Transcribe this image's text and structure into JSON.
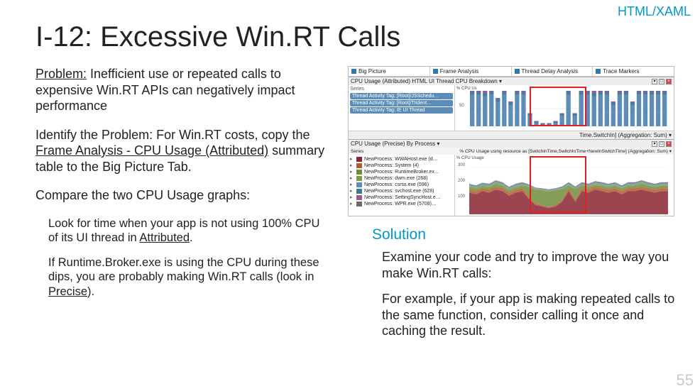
{
  "tag": "HTML/XAML",
  "title": "I-12: Excessive Win.RT Calls",
  "problem": {
    "label": "Problem:",
    "text": " Inefficient use or repeated calls to expensive Win.RT APIs can negatively impact performance"
  },
  "identify": {
    "label": "Identify the Problem:",
    "pre": " For Win.RT costs, copy the ",
    "link": "Frame Analysis - CPU Usage (Attributed)",
    "post": " summary table to the Big Picture Tab."
  },
  "compare": "Compare the two CPU Usage graphs:",
  "sub1": {
    "pre": "Look for time when your app is not using 100% CPU of its UI thread in ",
    "link": "Attributed",
    "post": "."
  },
  "sub2": {
    "pre": "If Runtime.Broker.exe is using the CPU during these dips, you are probably making Win.RT calls (look in ",
    "link": "Precise",
    "post": ")."
  },
  "solution": {
    "head": "Solution",
    "p1": "Examine your code and try to improve the way you make Win.RT calls:",
    "p2": "For example, if your app is making repeated calls to the same function, consider calling it once and caching the result."
  },
  "pagenum": "55",
  "shot": {
    "tabs": [
      "Big Picture",
      "Frame Analysis",
      "Thread Delay Analysis",
      "Trace Markers"
    ],
    "panel1": {
      "title": "CPU Usage (Attributed)   HTML UI Thread CPU Breakdown ▾",
      "right_title": "Time.SwitchIn] (Aggregation: Sum) ▾",
      "legend_head": "Series",
      "legend": [
        "Thread Activity Tag: [Root]/JSSchedu…",
        "Thread Activity Tag: [Root]/Trident…",
        "Thread Activity Tag: IE UI Thread"
      ],
      "ylabel": "% CPU Us",
      "ytick": "50"
    },
    "panel2": {
      "title": "CPU Usage (Precise)   By Process ▾",
      "right_title": "% CPU Usage using resource as [SwitchInTime,SwitchInTime+NewInSwitchTime] (Aggregation: Sum) ▾",
      "legend_head": "Series",
      "legend": [
        "NewProcess: WWAHost.exe (d…",
        "NewProcess: System (4)",
        "NewProcess: RuntimeBroker.ex…",
        "NewProcess: dwm.exe (268)",
        "NewProcess: csrss.exe (596)",
        "NewProcess: svchost.exe (628)",
        "NewProcess: SettingSyncHost.e…",
        "NewProcess: WPR.exe (5708)…"
      ],
      "ylabel": "% CPU Usage",
      "yticks": [
        "300",
        "200",
        "100"
      ]
    }
  },
  "chart_data": [
    {
      "type": "bar",
      "title": "CPU Usage (Attributed) HTML UI Thread CPU Breakdown",
      "ylabel": "% CPU Usage",
      "ylim": [
        0,
        100
      ],
      "series": [
        {
          "name": "Thread Activity Tag: [Root]/JSSchedu…",
          "values": [
            90,
            90,
            85,
            90,
            70,
            90,
            60,
            90,
            90,
            30,
            10,
            5,
            5,
            10,
            30,
            90,
            30,
            90,
            90,
            85,
            90,
            90,
            60,
            90,
            90,
            60,
            90,
            90,
            90,
            90,
            90
          ]
        },
        {
          "name": "Thread Activity Tag: [Root]/Trident…",
          "values": [
            8,
            8,
            10,
            8,
            8,
            8,
            8,
            8,
            8,
            5,
            3,
            2,
            2,
            3,
            5,
            8,
            5,
            8,
            8,
            10,
            8,
            8,
            8,
            8,
            8,
            8,
            8,
            8,
            8,
            8,
            8
          ]
        },
        {
          "name": "Thread Activity Tag: IE UI Thread",
          "values": [
            2,
            2,
            5,
            2,
            2,
            2,
            2,
            2,
            2,
            2,
            2,
            2,
            2,
            2,
            2,
            2,
            2,
            2,
            2,
            5,
            2,
            2,
            2,
            2,
            2,
            2,
            2,
            2,
            2,
            2,
            2
          ]
        }
      ]
    },
    {
      "type": "area",
      "title": "CPU Usage (Precise) By Process",
      "ylabel": "% CPU Usage",
      "ylim": [
        0,
        350
      ],
      "series": [
        {
          "name": "NewProcess: WWAHost.exe",
          "values": [
            140,
            130,
            150,
            140,
            160,
            150,
            120,
            140,
            150,
            100,
            60,
            50,
            40,
            50,
            80,
            150,
            80,
            150,
            140,
            160,
            150,
            140,
            150,
            130,
            150,
            150,
            160,
            150,
            140,
            150,
            150
          ]
        },
        {
          "name": "NewProcess: System (4)",
          "values": [
            20,
            20,
            18,
            20,
            18,
            20,
            20,
            20,
            20,
            15,
            10,
            10,
            8,
            10,
            12,
            20,
            12,
            20,
            20,
            18,
            20,
            20,
            20,
            20,
            20,
            20,
            18,
            20,
            20,
            20,
            20
          ]
        },
        {
          "name": "NewProcess: RuntimeBroker.exe",
          "values": [
            15,
            15,
            12,
            15,
            18,
            15,
            15,
            15,
            15,
            60,
            90,
            95,
            100,
            95,
            70,
            15,
            70,
            15,
            15,
            12,
            15,
            15,
            15,
            15,
            15,
            15,
            18,
            15,
            15,
            15,
            15
          ]
        },
        {
          "name": "NewProcess: dwm.exe (268)",
          "values": [
            10,
            10,
            12,
            10,
            12,
            10,
            10,
            10,
            10,
            8,
            6,
            6,
            6,
            6,
            8,
            10,
            8,
            10,
            10,
            12,
            10,
            10,
            10,
            10,
            10,
            10,
            12,
            10,
            10,
            10,
            10
          ]
        },
        {
          "name": "NewProcess: csrss.exe (596)",
          "values": [
            5,
            5,
            5,
            5,
            5,
            5,
            5,
            5,
            5,
            4,
            3,
            3,
            3,
            3,
            4,
            5,
            4,
            5,
            5,
            5,
            5,
            5,
            5,
            5,
            5,
            5,
            5,
            5,
            5,
            5,
            5
          ]
        },
        {
          "name": "NewProcess: svchost.exe (628)",
          "values": [
            5,
            5,
            5,
            5,
            5,
            5,
            5,
            5,
            5,
            4,
            3,
            3,
            3,
            3,
            4,
            5,
            4,
            5,
            5,
            5,
            5,
            5,
            5,
            5,
            5,
            5,
            5,
            5,
            5,
            5,
            5
          ]
        },
        {
          "name": "NewProcess: SettingSyncHost.exe",
          "values": [
            3,
            3,
            3,
            3,
            3,
            3,
            3,
            3,
            3,
            3,
            2,
            2,
            2,
            2,
            3,
            3,
            3,
            3,
            3,
            3,
            3,
            3,
            3,
            3,
            3,
            3,
            3,
            3,
            3,
            3,
            3
          ]
        },
        {
          "name": "NewProcess: WPR.exe (5708)",
          "values": [
            0,
            0,
            0,
            0,
            0,
            0,
            0,
            0,
            0,
            0,
            0,
            0,
            0,
            0,
            0,
            0,
            0,
            0,
            0,
            0,
            0,
            0,
            0,
            0,
            0,
            0,
            0,
            0,
            0,
            0,
            0
          ]
        }
      ]
    }
  ]
}
